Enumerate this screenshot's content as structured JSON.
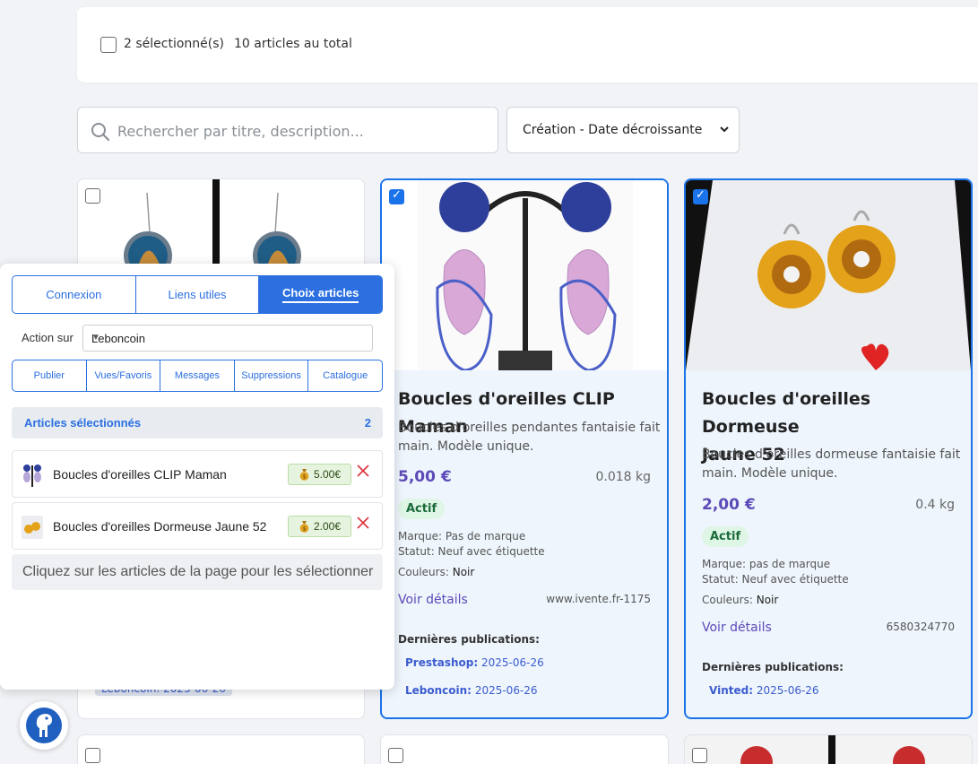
{
  "header": {
    "selected_label": "2 sélectionné(s)",
    "total_label": "10 articles au total"
  },
  "search": {
    "placeholder": "Rechercher par titre, description..."
  },
  "sort": {
    "value": "Création - Date décroissante"
  },
  "cards": [
    {
      "title": "Boucles d'oreilles CLIP Maman",
      "description_line1": "Boucles d'oreilles pendantes fantaisie fait",
      "description_line2": "main. Modèle unique.",
      "price": "5,00 €",
      "weight": "0.018 kg",
      "status_badge": "Actif",
      "brand": "Marque: Pas de marque",
      "condition": "Statut: Neuf avec étiquette",
      "colors_label": "Couleurs:",
      "colors_value": "Noir",
      "details_link": "Voir détails",
      "reference": "www.ivente.fr-1175",
      "publications_title": "Dernières publications:",
      "publications": [
        {
          "platform": "Prestashop:",
          "date": "2025-06-26"
        },
        {
          "platform": "Leboncoin:",
          "date": "2025-06-26"
        }
      ]
    },
    {
      "title_line1": "Boucles d'oreilles Dormeuse",
      "title_line2": "Jaune 52",
      "description_line1": "Boucles d'oreilles dormeuse fantaisie fait",
      "description_line2": "main. Modèle unique.",
      "price": "2,00 €",
      "weight": "0.4 kg",
      "status_badge": "Actif",
      "brand": "Marque: pas de marque",
      "condition": "Statut: Neuf avec étiquette",
      "colors_label": "Couleurs:",
      "colors_value": "Noir",
      "details_link": "Voir détails",
      "reference": "6580324770",
      "publications_title": "Dernières publications:",
      "publications": [
        {
          "platform": "Vinted:",
          "date": "2025-06-26"
        }
      ]
    }
  ],
  "partial_pub": "Leboncoin: 2025-06-26",
  "panel": {
    "tabs": [
      "Connexion",
      "Liens utiles",
      "Choix articles"
    ],
    "active_tab": "Choix articles",
    "action_label": "Action sur",
    "action_value": "Leboncoin",
    "subtabs": [
      "Publier",
      "Vues/Favoris",
      "Messages",
      "Suppressions",
      "Catalogue"
    ],
    "section_title": "Articles sélectionnés",
    "section_count": "2",
    "items": [
      {
        "name": "Boucles d'oreilles CLIP Maman",
        "price": "5.00€"
      },
      {
        "name": "Boucles d'oreilles Dormeuse Jaune 52",
        "price": "2.00€"
      }
    ],
    "hint": "Cliquez sur les articles de la page pour les sélectionner"
  },
  "colors": {
    "accent": "#2b6fe0",
    "price": "#5d4ab8",
    "active_badge": "#dff5e6"
  }
}
